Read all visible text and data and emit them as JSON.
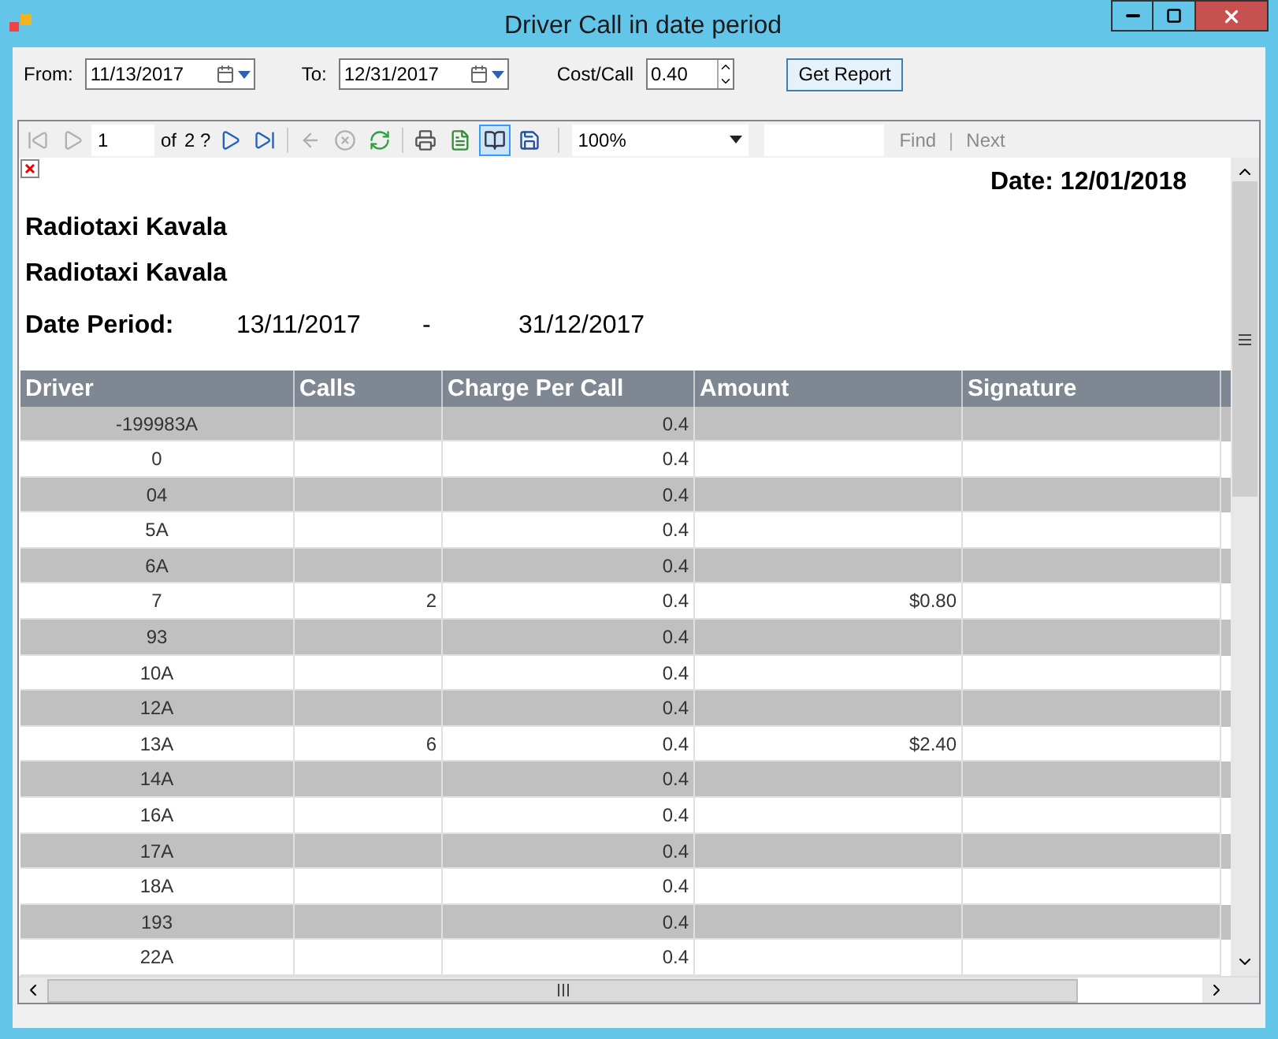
{
  "window": {
    "title": "Driver Call in date period"
  },
  "filters": {
    "from_label": "From:",
    "from_value": "11/13/2017",
    "to_label": "To:",
    "to_value": "12/31/2017",
    "cost_label": "Cost/Call",
    "cost_value": "0.40",
    "button": "Get Report"
  },
  "toolbar": {
    "page": "1",
    "of_label": "of",
    "page_count": "2 ?",
    "print_layout_selected": true,
    "zoom": "100%",
    "find_label": "Find",
    "separator": "|",
    "next_label": "Next"
  },
  "report": {
    "date_label": "Date: 12/01/2018",
    "company_lines": [
      "Radiotaxi Kavala",
      "Radiotaxi Kavala"
    ],
    "period_label": "Date Period:",
    "period_from": "13/11/2017",
    "period_sep": "-",
    "period_to": "31/12/2017",
    "table": {
      "columns": [
        "Driver",
        "Calls",
        "Charge Per Call",
        "Amount",
        "Signature"
      ],
      "rows": [
        {
          "driver": "-199983A",
          "calls": "",
          "charge": "0.4",
          "amount": ""
        },
        {
          "driver": "0",
          "calls": "",
          "charge": "0.4",
          "amount": ""
        },
        {
          "driver": "04",
          "calls": "",
          "charge": "0.4",
          "amount": ""
        },
        {
          "driver": "5A",
          "calls": "",
          "charge": "0.4",
          "amount": ""
        },
        {
          "driver": "6A",
          "calls": "",
          "charge": "0.4",
          "amount": ""
        },
        {
          "driver": "7",
          "calls": "2",
          "charge": "0.4",
          "amount": "$0.80"
        },
        {
          "driver": "93",
          "calls": "",
          "charge": "0.4",
          "amount": ""
        },
        {
          "driver": "10A",
          "calls": "",
          "charge": "0.4",
          "amount": ""
        },
        {
          "driver": "12A",
          "calls": "",
          "charge": "0.4",
          "amount": ""
        },
        {
          "driver": "13A",
          "calls": "6",
          "charge": "0.4",
          "amount": "$2.40"
        },
        {
          "driver": "14A",
          "calls": "",
          "charge": "0.4",
          "amount": ""
        },
        {
          "driver": "16A",
          "calls": "",
          "charge": "0.4",
          "amount": ""
        },
        {
          "driver": "17A",
          "calls": "",
          "charge": "0.4",
          "amount": ""
        },
        {
          "driver": "18A",
          "calls": "",
          "charge": "0.4",
          "amount": ""
        },
        {
          "driver": "193",
          "calls": "",
          "charge": "0.4",
          "amount": ""
        },
        {
          "driver": "22A",
          "calls": "",
          "charge": "0.4",
          "amount": ""
        }
      ]
    }
  }
}
